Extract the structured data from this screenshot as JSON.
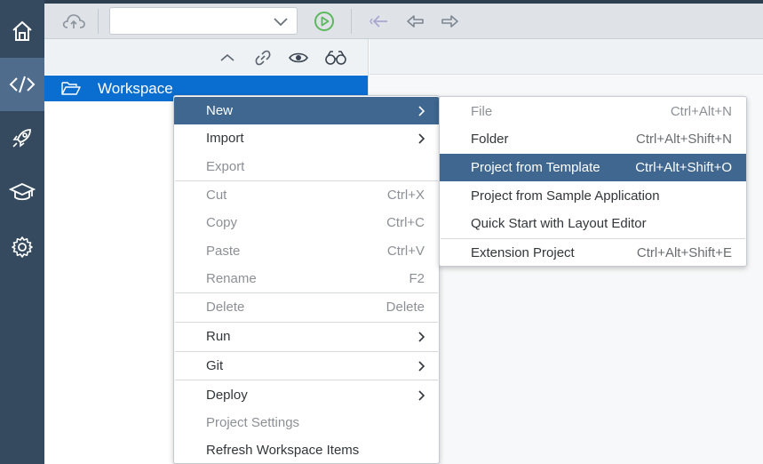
{
  "toolbar": {
    "project_select_value": "",
    "icons": [
      "cloud-upload-icon",
      "run-icon",
      "navigate-last-edit-icon",
      "navigate-back-icon",
      "navigate-forward-icon"
    ]
  },
  "leftbar": {
    "items": [
      {
        "name": "home",
        "icon": "home-icon"
      },
      {
        "name": "development",
        "icon": "code-icon",
        "active": true
      },
      {
        "name": "deploy",
        "icon": "rocket-icon"
      },
      {
        "name": "learning",
        "icon": "education-icon"
      },
      {
        "name": "preferences",
        "icon": "gear-icon"
      }
    ]
  },
  "explorer": {
    "header_icons": [
      "collapse-all-icon",
      "link-with-editor-icon",
      "show-hidden-files-icon",
      "search-icon"
    ],
    "workspace_label": "Workspace"
  },
  "context_menu": {
    "new": "New",
    "import": "Import",
    "export": "Export",
    "cut": "Cut",
    "cut_sc": "Ctrl+X",
    "copy": "Copy",
    "copy_sc": "Ctrl+C",
    "paste": "Paste",
    "paste_sc": "Ctrl+V",
    "rename": "Rename",
    "rename_sc": "F2",
    "delete": "Delete",
    "delete_sc": "Delete",
    "run": "Run",
    "git": "Git",
    "deploy": "Deploy",
    "project_settings": "Project Settings",
    "refresh": "Refresh Workspace Items"
  },
  "submenu": {
    "file": "File",
    "file_sc": "Ctrl+Alt+N",
    "folder": "Folder",
    "folder_sc": "Ctrl+Alt+Shift+N",
    "project_from_template": "Project from Template",
    "project_from_template_sc": "Ctrl+Alt+Shift+O",
    "project_from_sample": "Project from Sample Application",
    "quick_start": "Quick Start with Layout Editor",
    "extension_project": "Extension Project",
    "extension_project_sc": "Ctrl+Alt+Shift+E"
  },
  "colors": {
    "rail": "#354a5f",
    "rail_active": "#4f6c8c",
    "selection": "#0a6ed1",
    "menu_highlight": "#3f678f",
    "run_green": "#5cb85c"
  }
}
